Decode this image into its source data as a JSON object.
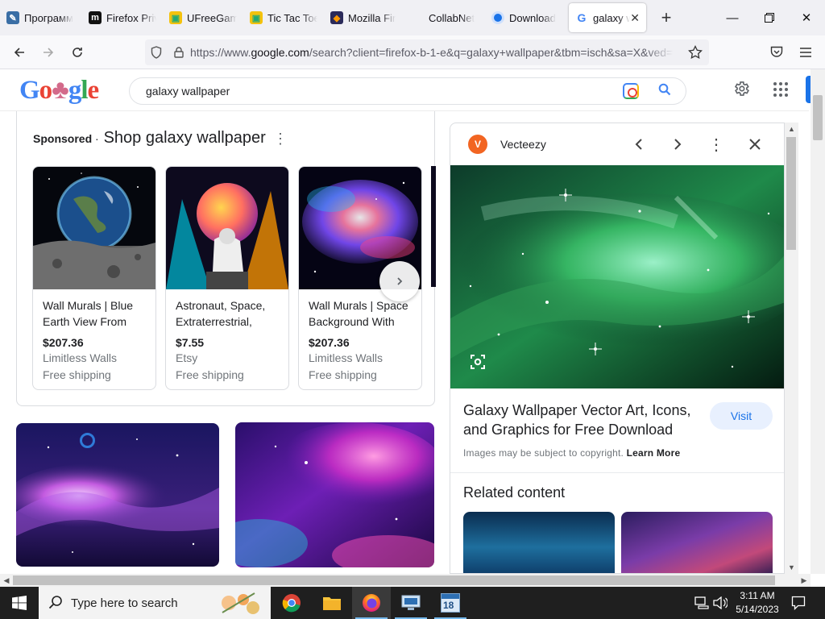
{
  "browser": {
    "tabs": [
      {
        "label": "Программ",
        "icon": "blue-tool-icon"
      },
      {
        "label": "Firefox Priv",
        "icon": "m-logo-icon"
      },
      {
        "label": "UFreeGam",
        "icon": "game-icon"
      },
      {
        "label": "Tic Tac Toe",
        "icon": "game-icon"
      },
      {
        "label": "Mozilla Fir",
        "icon": "mozilla-icon"
      },
      {
        "label": "CollabNet",
        "icon": ""
      },
      {
        "label": "Download",
        "icon": "chrome-icon"
      },
      {
        "label": "galaxy w",
        "icon": "google-icon",
        "active": true
      }
    ],
    "url_prefix": "https://www.",
    "url_domain": "google.com",
    "url_rest": "/search?client=firefox-b-1-e&q=galaxy+wallpaper&tbm=isch&sa=X&ved="
  },
  "google": {
    "logo": "Google",
    "query": "galaxy wallpaper"
  },
  "sponsored": {
    "label": "Sponsored",
    "separator": " · ",
    "heading": "Shop galaxy wallpaper",
    "products": [
      {
        "title": "Wall Murals | Blue Earth View From",
        "price": "$207.36",
        "store": "Limitless Walls",
        "shipping": "Free shipping"
      },
      {
        "title": "Astronaut, Space, Extraterrestrial,",
        "price": "$7.55",
        "store": "Etsy",
        "shipping": "Free shipping"
      },
      {
        "title": "Wall Murals | Space Background With",
        "price": "$207.36",
        "store": "Limitless Walls",
        "shipping": "Free shipping"
      }
    ]
  },
  "panel": {
    "source": "Vecteezy",
    "title": "Galaxy Wallpaper Vector Art, Icons, and Graphics for Free Download",
    "visit": "Visit",
    "copyright": "Images may be subject to copyright.",
    "learn_more": "Learn More",
    "related": "Related content"
  },
  "taskbar": {
    "search_placeholder": "Type here to search",
    "time": "3:11 AM",
    "date": "5/14/2023",
    "badge": "18"
  },
  "colors": {
    "google_blue": "#4285f4",
    "accent": "#1a73e8",
    "taskbar": "#1f1f1f"
  }
}
